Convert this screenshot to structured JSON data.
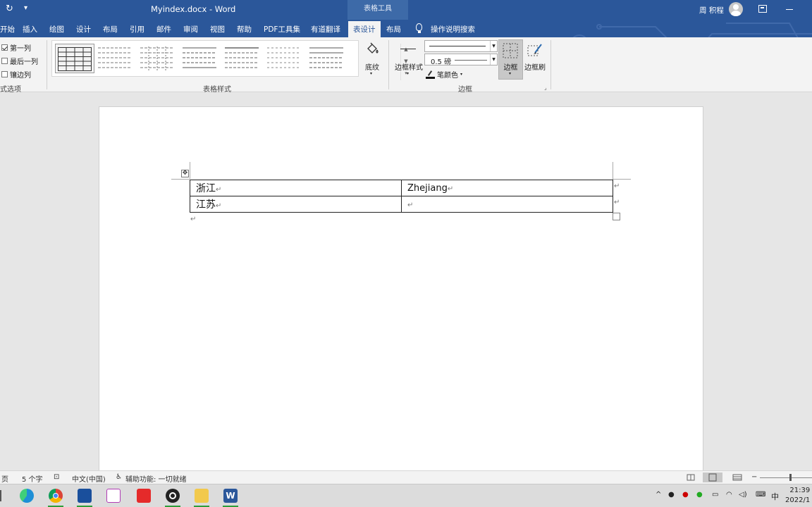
{
  "titlebar": {
    "doc_title": "Myindex.docx - Word",
    "context_group": "表格工具",
    "user_name": "周 积程"
  },
  "tabs": [
    "开始",
    "插入",
    "绘图",
    "设计",
    "布局",
    "引用",
    "邮件",
    "审阅",
    "视图",
    "帮助",
    "PDF工具集",
    "有道翻译",
    "表设计",
    "布局"
  ],
  "active_tab": "表设计",
  "tell_me": "操作说明搜索",
  "ribbon": {
    "options": [
      {
        "label": "第一列",
        "checked": true
      },
      {
        "label": "最后一列",
        "checked": false
      },
      {
        "label": "镶边列",
        "checked": false
      }
    ],
    "options_group": "式选项",
    "styles_group": "表格样式",
    "shading": "底纹",
    "border_styles": "边框样式",
    "pen_weight": "0.5 磅",
    "pen_color": "笔颜色",
    "borders": "边框",
    "border_painter": "边框刷",
    "borders_group": "边框"
  },
  "document": {
    "rows": [
      [
        "浙江",
        "Zhejiang"
      ],
      [
        "江苏",
        ""
      ]
    ],
    "cell_mark": "↵"
  },
  "status": {
    "page": "页",
    "words": "5 个字",
    "language": "中文(中国)",
    "accessibility": "辅助功能: 一切就绪"
  },
  "taskbar": {
    "ime": "中",
    "time": "21:39",
    "date": "2022/1"
  }
}
